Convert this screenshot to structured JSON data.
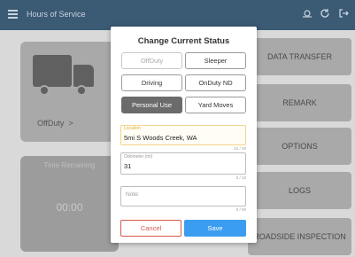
{
  "app_bar": {
    "title": "Hours of Service",
    "icons": [
      "menu-icon",
      "gps-icon",
      "refresh-icon",
      "logout-icon"
    ]
  },
  "truck_card": {
    "status": "OffDuty",
    "chevron": ">"
  },
  "time_card": {
    "label": "Time Remaining",
    "value": "00:00"
  },
  "side_buttons": [
    "DATA TRANSFER",
    "REMARK",
    "OPTIONS",
    "LOGS",
    "ROADSIDE INSPECTION"
  ],
  "dialog": {
    "title": "Change Current Status",
    "statuses": [
      {
        "label": "OffDuty",
        "state": "disabled"
      },
      {
        "label": "Sleeper",
        "state": "normal"
      },
      {
        "label": "Driving",
        "state": "normal"
      },
      {
        "label": "OnDuty ND",
        "state": "normal"
      },
      {
        "label": "Personal Use",
        "state": "selected"
      },
      {
        "label": "Yard Moves",
        "state": "normal"
      }
    ],
    "location": {
      "label": "Location",
      "value": "5mi S Woods Creek, WA",
      "count": "21 / 40"
    },
    "odometer": {
      "label": "Odometer (mi)",
      "value": "31",
      "count": "2 / 10"
    },
    "note": {
      "placeholder": "Note:",
      "count": "0 / 60"
    },
    "cancel_label": "Cancel",
    "save_label": "Save"
  },
  "colors": {
    "app_bar": "#3b5a74",
    "save": "#3b9df0",
    "cancel": "#d8584a",
    "focus_field": "#f0d48a"
  }
}
